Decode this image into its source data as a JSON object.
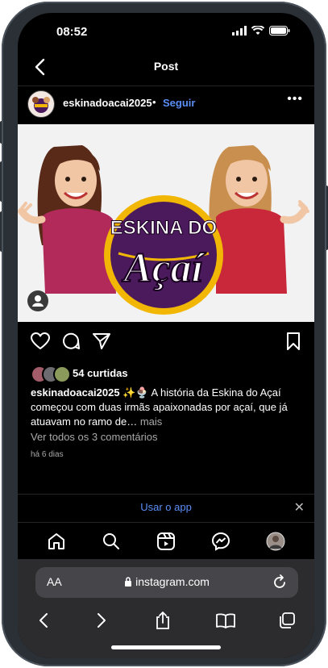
{
  "status_bar": {
    "time": "08:52"
  },
  "header": {
    "title": "Post"
  },
  "post": {
    "username": "eskinadoacai2025",
    "separator": "•",
    "follow_label": "Seguir",
    "more_label": "•••",
    "image_text": {
      "line1": "ESKINA DO",
      "line2": "Açaí"
    },
    "likes": "54 curtidas",
    "caption_user": "eskinadoacai2025",
    "caption_text": " ✨🍨 A história da Eskina do Açaí começou com duas irmãs apaixonadas por açaí, que já atuavam no ramo de…",
    "caption_more": " mais",
    "comments_link": "Ver todos os 3 comentários",
    "time_ago": "há 6 dias"
  },
  "banner": {
    "label": "Usar o app",
    "close": "✕"
  },
  "safari": {
    "aa_label": "AA",
    "url": "instagram.com"
  },
  "icons": {
    "back": "chevron-left-icon",
    "like": "heart-icon",
    "comment": "comment-icon",
    "share": "send-icon",
    "save": "bookmark-icon",
    "nav": [
      "home-icon",
      "search-icon",
      "reels-icon",
      "messenger-icon",
      "profile-avatar"
    ],
    "safari": [
      "back-icon",
      "forward-icon",
      "share-icon",
      "bookmarks-icon",
      "tabs-icon"
    ]
  },
  "colors": {
    "accent": "#5b8ef7",
    "background": "#000000",
    "logo_purple": "#4a1a5c",
    "logo_gold": "#f2b705"
  }
}
